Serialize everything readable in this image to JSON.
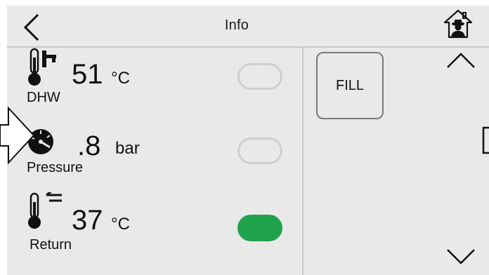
{
  "header": {
    "title": "Info",
    "back_icon": "chevron-left-icon",
    "home_icon": "home-technician-icon"
  },
  "rows": [
    {
      "icon": "dhw-thermometer-icon",
      "value": "51",
      "unit": "°C",
      "label": "DHW",
      "toggle_on": false
    },
    {
      "icon": "pressure-gauge-icon",
      "value": ".8",
      "unit": "bar",
      "label": "Pressure",
      "toggle_on": false
    },
    {
      "icon": "return-thermometer-icon",
      "value": "37",
      "unit": "°C",
      "label": "Return",
      "toggle_on": true
    }
  ],
  "fill_button": {
    "label": "FILL"
  },
  "scroll": {
    "up_icon": "chevron-up-icon",
    "down_icon": "chevron-down-icon"
  },
  "colors": {
    "panel": "#e9e9e9",
    "divider": "#c7c7c7",
    "toggle_on": "#21a24d",
    "toggle_off_border": "#cfcfcf"
  }
}
